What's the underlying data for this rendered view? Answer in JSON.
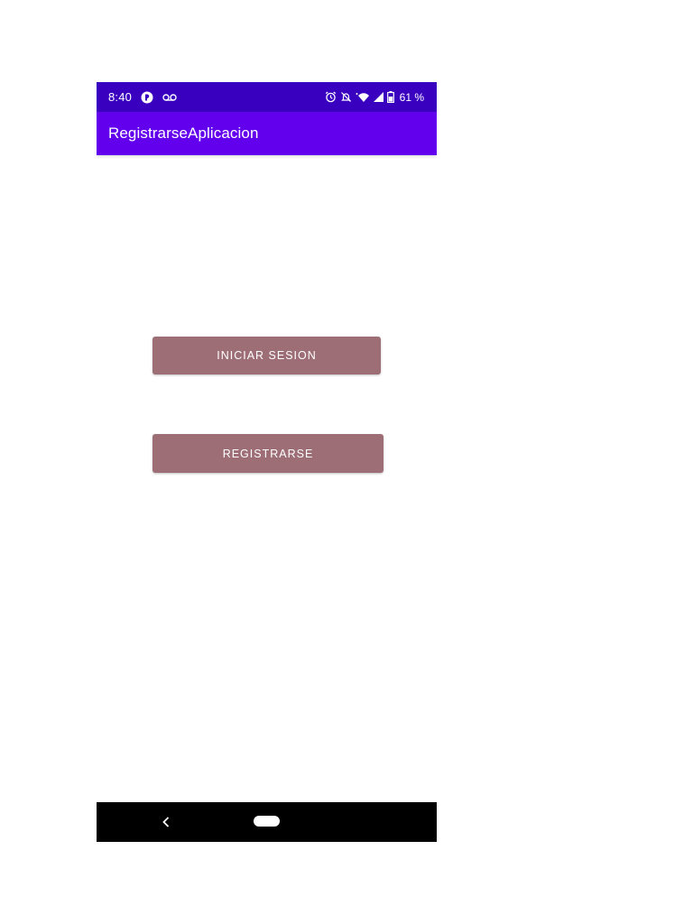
{
  "status_bar": {
    "time": "8:40",
    "battery_percent": "61 %",
    "left_icons": [
      "notification-app-icon",
      "voicemail-icon"
    ],
    "right_icons": [
      "alarm-icon",
      "bell-off-icon",
      "wifi-icon",
      "signal-icon",
      "battery-icon"
    ],
    "background_color": "#3a00c0"
  },
  "app_bar": {
    "title": "RegistrarseAplicacion",
    "background_color": "#6200ee"
  },
  "main": {
    "login_button_label": "INICIAR SESION",
    "register_button_label": "REGISTRARSE",
    "button_color": "#9e6e76"
  },
  "nav_bar": {
    "back_icon": "chevron-left-icon",
    "home_icon": "home-pill-icon",
    "background_color": "#000000"
  }
}
